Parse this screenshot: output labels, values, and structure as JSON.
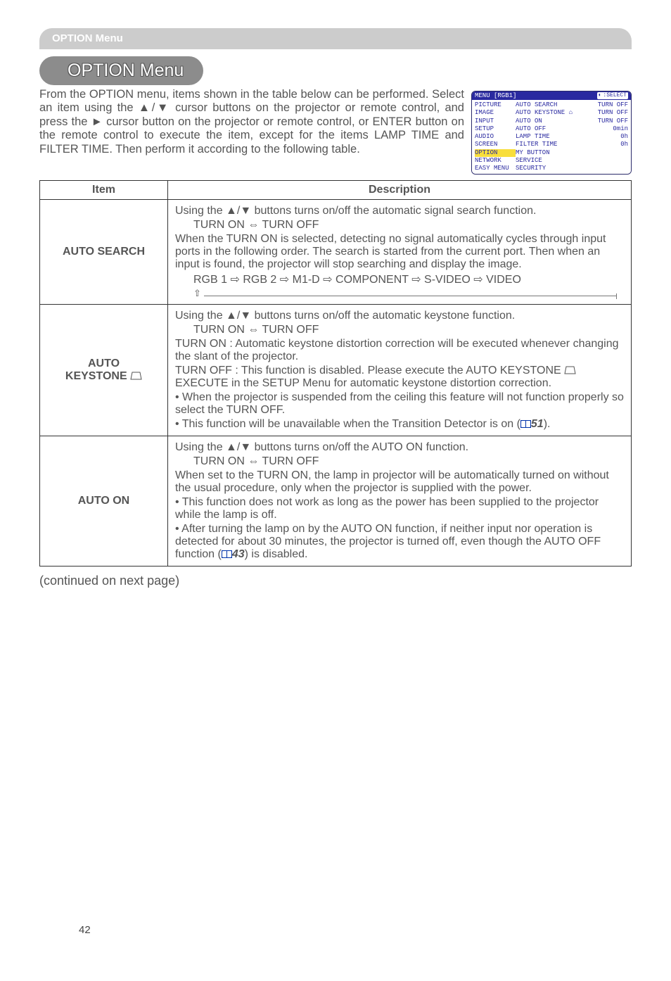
{
  "section_bar": "OPTION Menu",
  "title": "OPTION Menu",
  "intro": "From the OPTION menu, items shown in the table below can be performed.\nSelect an item using the ▲/▼ cursor buttons on the projector or remote control, and press the ► cursor button on the projector or remote control, or ENTER button on the remote control to execute the item, except for the items LAMP TIME and FILTER TIME. Then perform it according to the following table.",
  "menu_screenshot": {
    "header_left": "MENU [RGB1]",
    "header_right_icon": "select-icon",
    "header_right": ":SELECT",
    "left_items": [
      "PICTURE",
      "IMAGE",
      "INPUT",
      "SETUP",
      "AUDIO",
      "SCREEN",
      "OPTION",
      "NETWORK",
      "EASY MENU"
    ],
    "highlighted": "OPTION",
    "right_rows": [
      {
        "l": "AUTO SEARCH",
        "r": "TURN OFF"
      },
      {
        "l": "AUTO KEYSTONE ⌂",
        "r": "TURN OFF"
      },
      {
        "l": "AUTO ON",
        "r": "TURN OFF"
      },
      {
        "l": "AUTO OFF",
        "r": "0min"
      },
      {
        "l": "LAMP TIME",
        "r": "0h"
      },
      {
        "l": "FILTER TIME",
        "r": "0h"
      },
      {
        "l": "MY BUTTON",
        "r": ""
      },
      {
        "l": "SERVICE",
        "r": ""
      },
      {
        "l": "SECURITY",
        "r": ""
      }
    ]
  },
  "headers": {
    "item": "Item",
    "desc": "Description"
  },
  "rows": [
    {
      "item": "AUTO SEARCH",
      "keystone_icon": false,
      "desc": {
        "line1": "Using the ▲/▼ buttons turns on/off the automatic signal search function.",
        "toggle": "TURN ON ⇔ TURN OFF",
        "body": "When the TURN ON is selected, detecting no signal automatically cycles through input ports in the following order. The search is started from the current port. Then when an input is found, the projector will stop searching and display the image.",
        "chain": "RGB 1 ⇨ RGB 2 ⇨ M1-D ⇨ COMPONENT ⇨ S-VIDEO ⇨ VIDEO",
        "show_arrow_bar": true
      }
    },
    {
      "item": "AUTO KEYSTONE",
      "keystone_icon": true,
      "desc": {
        "line1": "Using the ▲/▼ buttons turns on/off the automatic keystone function.",
        "toggle": "TURN ON ⇔ TURN OFF",
        "p1": "TURN ON : Automatic keystone distortion correction will be executed whenever changing the slant of the projector.",
        "p2a": "TURN OFF : This function is disabled. Please execute the AUTO KEYSTONE ",
        "p2b": " EXECUTE in the SETUP Menu for automatic keystone distortion correction.",
        "b1": "• When the projector is suspended from the ceiling this feature will not function properly so select the TURN OFF.",
        "b2a": "• This function will be unavailable when the Transition Detector is on (",
        "b2_ref": "51",
        "b2b": ")."
      }
    },
    {
      "item": "AUTO ON",
      "keystone_icon": false,
      "desc": {
        "line1": "Using the ▲/▼ buttons turns on/off the AUTO ON function.",
        "toggle": "TURN ON ⇔ TURN OFF",
        "p1": "When set to the TURN ON, the lamp in projector will be automatically turned on without the usual procedure, only when the projector is supplied with the power.",
        "b1": "• This function does not work as long as the power has been supplied to the projector while the lamp is off.",
        "b2a": "• After turning the lamp on by the AUTO ON function, if neither input nor operation is detected for about 30 minutes, the projector is turned off, even though the AUTO OFF function (",
        "b2_ref": "43",
        "b2b": ") is disabled."
      }
    }
  ],
  "continued": "(continued on next page)",
  "page_number": "42"
}
